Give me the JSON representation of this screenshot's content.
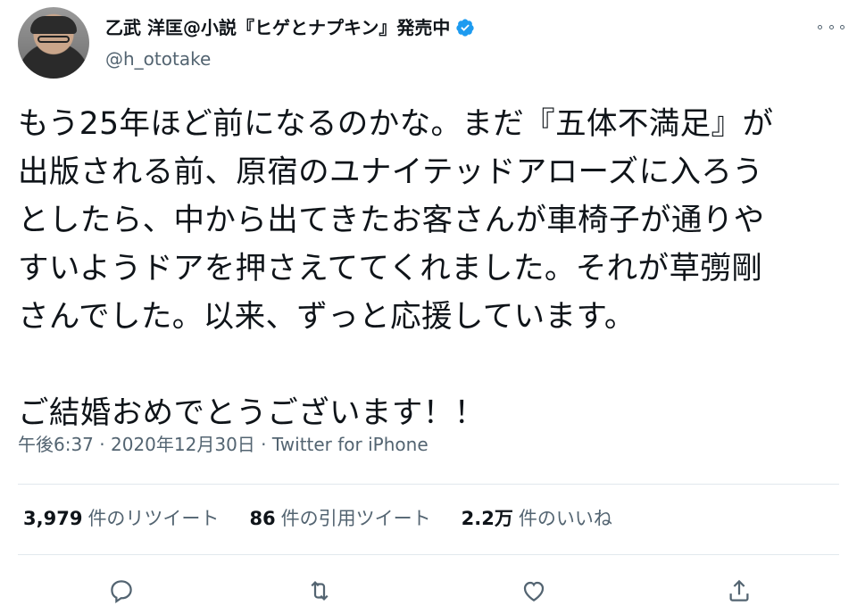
{
  "author": {
    "display_name": "乙武 洋匡@小説『ヒゲとナプキン』発売中",
    "handle": "@h_ototake",
    "verified": true,
    "verified_color": "#1d9bf0"
  },
  "tweet": {
    "text": "もう25年ほど前になるのかな。まだ『五体不満足』が\n出版される前、原宿のユナイテッドアローズに入ろう\nとしたら、中から出てきたお客さんが車椅子が通りや\nすいようドアを押さえててくれました。それが草彅剛\nさんでした。以来、ずっと応援しています。\n\nご結婚おめでとうございます！！",
    "time": "午後6:37",
    "date": "2020年12月30日",
    "source": "Twitter for iPhone",
    "separator": "·"
  },
  "stats": {
    "retweets_count": "3,979",
    "retweets_label": "件のリツイート",
    "quotes_count": "86",
    "quotes_label": "件の引用ツイート",
    "likes_count": "2.2万",
    "likes_label": "件のいいね"
  },
  "actions": {
    "reply_icon": "reply-icon",
    "retweet_icon": "retweet-icon",
    "like_icon": "heart-icon",
    "share_icon": "share-icon"
  },
  "colors": {
    "text": "#0f1419",
    "muted": "#536471",
    "divider": "#e1e8ed"
  }
}
